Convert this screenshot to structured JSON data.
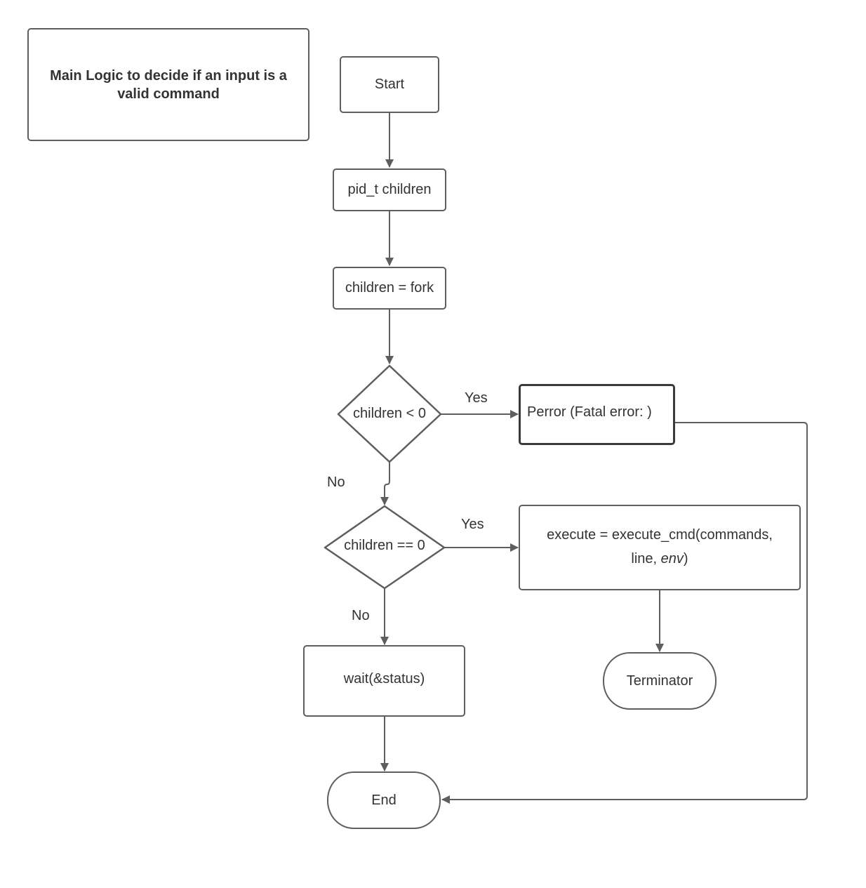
{
  "diagram": {
    "title": "Main Logic to decide if an input is a valid command",
    "nodes": {
      "start": "Start",
      "declare": "pid_t children",
      "fork": "children = fork",
      "check_negative": "children < 0",
      "perror": "Perror (Fatal error: )",
      "check_zero": "children == 0",
      "execute_line1": "execute = execute_cmd(commands,",
      "execute_line2_a": "line, ",
      "execute_line2_italic": "env",
      "execute_line2_b": ")",
      "wait": "wait(&status)",
      "terminator": "Terminator",
      "end": "End"
    },
    "edge_labels": {
      "neg_yes": "Yes",
      "neg_no": "No",
      "zero_yes": "Yes",
      "zero_no": "No"
    },
    "colors": {
      "stroke": "#5e5e5e",
      "text": "#333333",
      "background": "#ffffff"
    }
  }
}
